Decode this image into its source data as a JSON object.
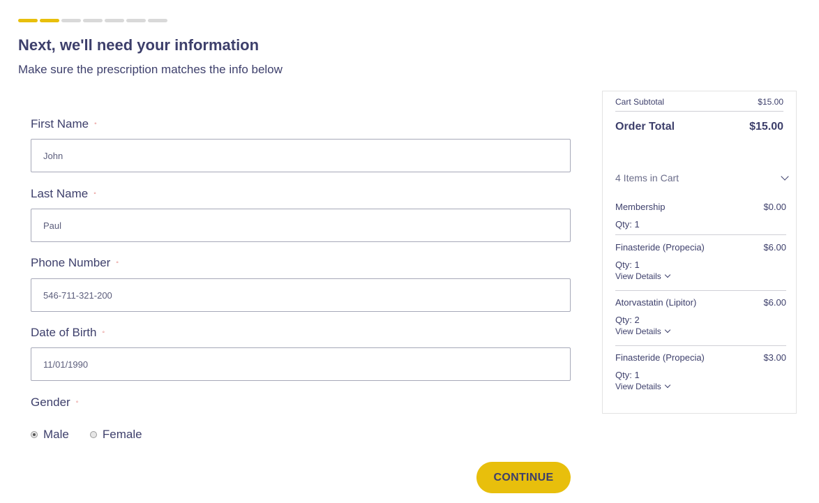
{
  "progress": {
    "total_steps": 7,
    "completed_steps": 2,
    "accent_color": "#e8bf0c"
  },
  "header": {
    "title": "Next, we'll need your information",
    "subtitle": "Make sure the prescription matches the info below"
  },
  "form": {
    "first_name": {
      "label": "First Name",
      "required_mark": "◦",
      "value": "John"
    },
    "last_name": {
      "label": "Last Name",
      "required_mark": "◦",
      "value": "Paul"
    },
    "phone": {
      "label": "Phone Number",
      "required_mark": "◦",
      "value": "546-711-321-200"
    },
    "dob": {
      "label": "Date of Birth",
      "required_mark": "◦",
      "value": "11/01/1990"
    },
    "gender": {
      "label": "Gender",
      "required_mark": "◦",
      "options": [
        "Male",
        "Female"
      ],
      "selected": "Male"
    },
    "continue_label": "CONTINUE"
  },
  "cart": {
    "subtotal_label": "Cart Subtotal",
    "subtotal_value": "$15.00",
    "total_label": "Order Total",
    "total_value": "$15.00",
    "items_count_label": "4 Items in Cart",
    "items": [
      {
        "name": "Membership",
        "price": "$0.00",
        "qty": "Qty: 1",
        "details": ""
      },
      {
        "name": "Finasteride (Propecia)",
        "price": "$6.00",
        "qty": "Qty: 1",
        "details": "View Details"
      },
      {
        "name": "Atorvastatin (Lipitor)",
        "price": "$6.00",
        "qty": "Qty: 2",
        "details": "View Details"
      },
      {
        "name": "Finasteride (Propecia)",
        "price": "$3.00",
        "qty": "Qty: 1",
        "details": "View Details"
      }
    ]
  }
}
